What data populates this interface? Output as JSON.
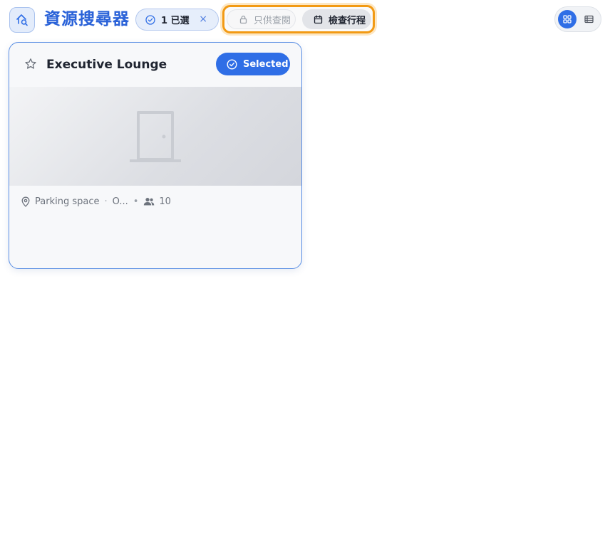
{
  "header": {
    "app_icon": "search-resource-icon",
    "title": "資源搜尋器",
    "selection_chip": {
      "icon": "check-circle-icon",
      "label": "1 已選",
      "clear_label": "×"
    },
    "mode_group": {
      "readonly": {
        "icon": "lock-icon",
        "label": "只供查閱"
      },
      "schedule": {
        "icon": "calendar-icon",
        "label": "檢查行程"
      }
    },
    "view_toggle": {
      "grid_icon": "grid-view-icon",
      "list_icon": "list-view-icon",
      "active": "grid"
    }
  },
  "colors": {
    "accent": "#2f6ee6",
    "highlight_border": "#f29a14",
    "title": "#2a62d8"
  },
  "cards": [
    {
      "title": "Executive Lounge",
      "favorite_icon": "star-outline-icon",
      "badge_label": "Selected",
      "badge_icon": "check-circle-icon",
      "image_placeholder_icon": "door-icon",
      "location_icon": "map-pin-icon",
      "location": "Parking space",
      "location_extra": "O...",
      "capacity_icon": "users-icon",
      "capacity": "10"
    }
  ]
}
